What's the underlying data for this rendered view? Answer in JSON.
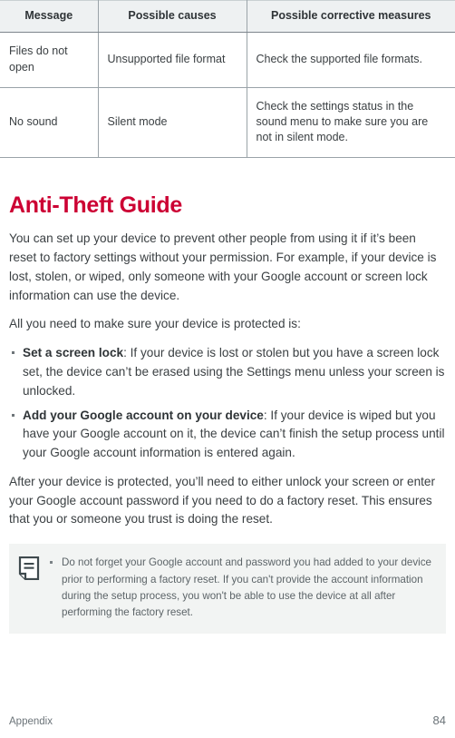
{
  "table": {
    "headers": [
      "Message",
      "Possible causes",
      "Possible corrective measures"
    ],
    "rows": [
      {
        "message": "Files do not open",
        "cause": "Unsupported file format",
        "measure": "Check the supported file formats."
      },
      {
        "message": "No sound",
        "cause": "Silent mode",
        "measure": "Check the settings status in the sound menu to make sure you are not in silent mode."
      }
    ]
  },
  "section": {
    "title": "Anti-Theft Guide",
    "title_color": "#cc0033",
    "intro": "You can set up your device to prevent other people from using it if it’s been reset to factory settings without your permission. For example, if your device is lost, stolen, or wiped, only someone with your Google account or screen lock information can use the device.",
    "list_intro": "All you need to make sure your device is protected is:",
    "items": [
      {
        "lead_in": "Set a screen lock",
        "body": ": If your device is lost or stolen but you have a screen lock set, the device can’t be erased using the Settings menu unless your screen is unlocked."
      },
      {
        "lead_in": "Add your Google account on your device",
        "body": ": If your device is wiped but you have your Google account on it, the device can’t finish the setup process until your Google account information is entered again."
      }
    ],
    "outro": "After your device is protected, you’ll need to either unlock your screen or enter your Google account password if you need to do a factory reset. This ensures that you or someone you trust is doing the reset."
  },
  "note": {
    "icon": "note-document-icon",
    "text": "Do not forget your Google account and password you had added to your device prior to performing a factory reset. If you can't provide the account information during the setup process, you won't be able to use the device at all after performing the factory reset."
  },
  "footer": {
    "section_label": "Appendix",
    "page_number": "84"
  }
}
